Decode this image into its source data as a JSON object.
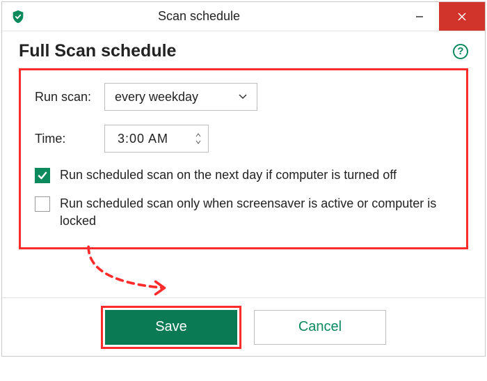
{
  "window": {
    "title": "Scan schedule"
  },
  "section": {
    "title": "Full Scan schedule",
    "help_char": "?"
  },
  "form": {
    "run_scan_label": "Run scan:",
    "run_scan_value": "every weekday",
    "time_label": "Time:",
    "time_value": "3:00 AM",
    "checkbox1_label": "Run scheduled scan on the next day if computer is turned off",
    "checkbox1_checked": "true",
    "checkbox2_label": "Run scheduled scan only when screensaver is active or computer is locked",
    "checkbox2_checked": "false"
  },
  "buttons": {
    "save": "Save",
    "cancel": "Cancel"
  }
}
